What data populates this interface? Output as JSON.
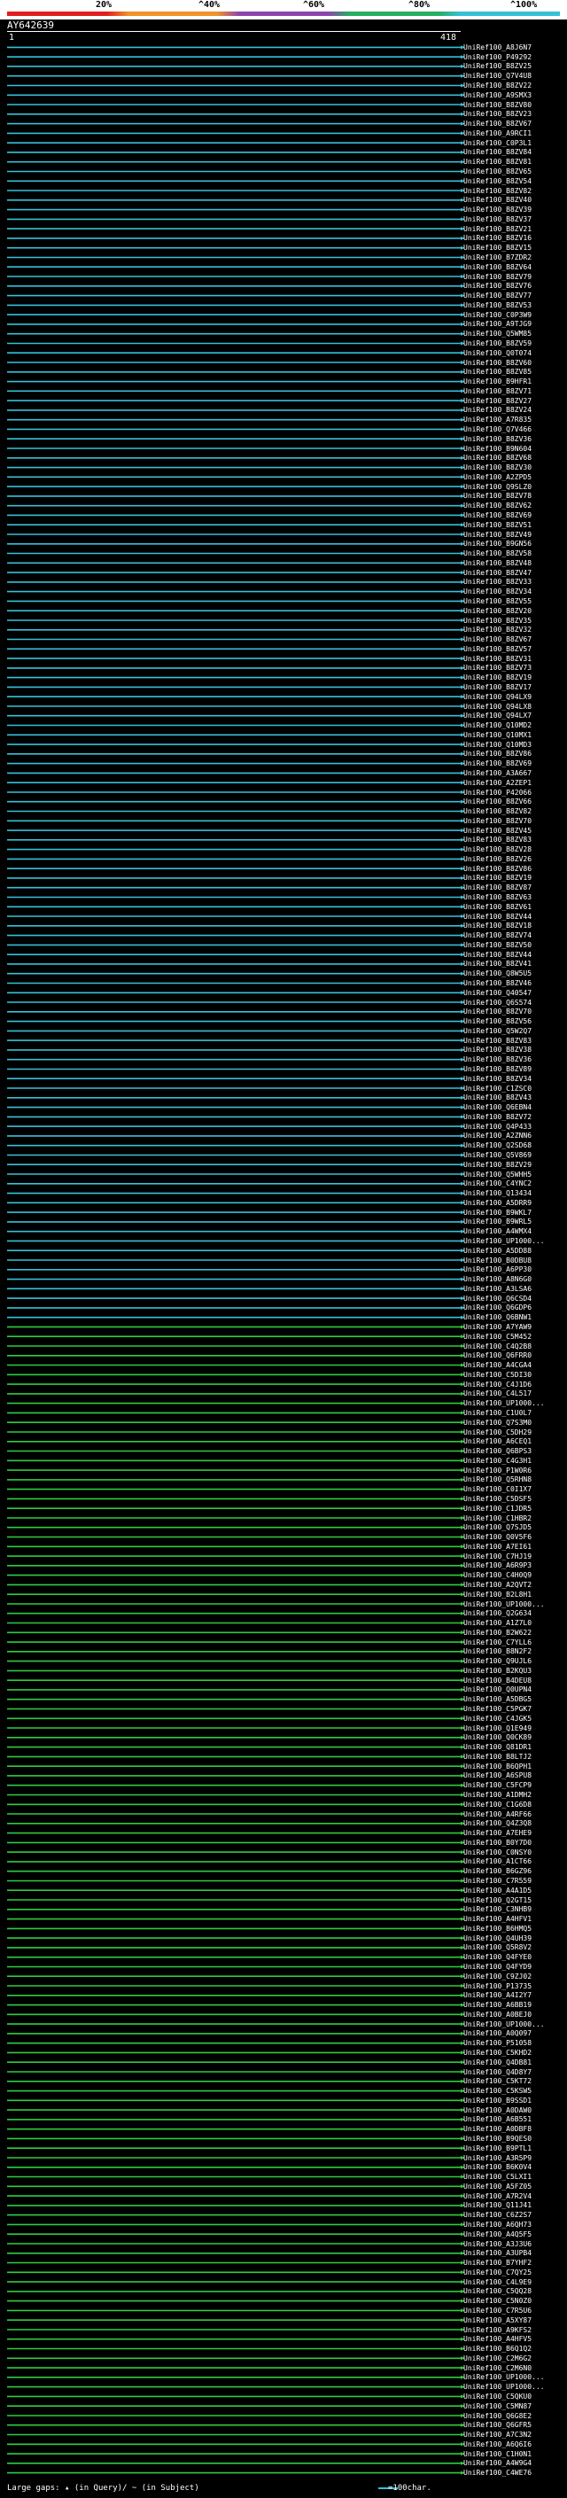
{
  "header": {
    "scale_labels": [
      "20%",
      "^40%",
      "^60%",
      "^80%",
      "^100%"
    ],
    "gradient_colors": [
      "#e11d1d",
      "#f0932a",
      "#8e44ad",
      "#27ae60",
      "#37c1d6"
    ]
  },
  "query": {
    "name": "AY642639",
    "start": "1",
    "end": "418"
  },
  "colors": {
    "cyan": "#37c1d6",
    "green": "#2ecc40",
    "gap": "#ffffff"
  },
  "hits": {
    "cyan_labels": [
      "UniRef100_A8J6N7",
      "UniRef100_P49292",
      "UniRef100_B8ZV25",
      "UniRef100_Q7V4U8",
      "UniRef100_B8ZV22",
      "UniRef100_A9SMX3",
      "UniRef100_B8ZV80",
      "UniRef100_B8ZV23",
      "UniRef100_B8ZV67",
      "UniRef100_A9RCI1",
      "UniRef100_C0P3L1",
      "UniRef100_B8ZV84",
      "UniRef100_B8ZV81",
      "UniRef100_B8ZV65",
      "UniRef100_B8ZV54",
      "UniRef100_B8ZV82",
      "UniRef100_B8ZV40",
      "UniRef100_B8ZV39",
      "UniRef100_B8ZV37",
      "UniRef100_B8ZV21",
      "UniRef100_B8ZV16",
      "UniRef100_B8ZV15",
      "UniRef100_B7ZDR2",
      "UniRef100_B8ZV64",
      "UniRef100_B8ZV79",
      "UniRef100_B8ZV76",
      "UniRef100_B8ZV77",
      "UniRef100_B8ZV53",
      "UniRef100_C0P3W9",
      "UniRef100_A9TJG9",
      "UniRef100_Q5WM85",
      "UniRef100_B8ZV59",
      "UniRef100_Q0T074",
      "UniRef100_B8ZV60",
      "UniRef100_B8ZV85",
      "UniRef100_B9HFR1",
      "UniRef100_B8ZV71",
      "UniRef100_B8ZV27",
      "UniRef100_B8ZV24",
      "UniRef100_A7R835",
      "UniRef100_Q7V466",
      "UniRef100_B8ZV36",
      "UniRef100_B9N604",
      "UniRef100_B8ZV68",
      "UniRef100_B8ZV30",
      "UniRef100_A2ZPD5",
      "UniRef100_Q9SLZ0",
      "UniRef100_B8ZV78",
      "UniRef100_B8ZV62",
      "UniRef100_B8ZV69",
      "UniRef100_B8ZV51",
      "UniRef100_B8ZV49",
      "UniRef100_B9GN56",
      "UniRef100_B8ZV58",
      "UniRef100_B8ZV48",
      "UniRef100_B8ZV47",
      "UniRef100_B8ZV33",
      "UniRef100_B8ZV34",
      "UniRef100_B8ZV55",
      "UniRef100_B8ZV20",
      "UniRef100_B8ZV35",
      "UniRef100_B8ZV32",
      "UniRef100_B8ZV67",
      "UniRef100_B8ZV57",
      "UniRef100_B8ZV31",
      "UniRef100_B8ZV73",
      "UniRef100_B8ZV19",
      "UniRef100_B8ZV17",
      "UniRef100_Q94LX9",
      "UniRef100_Q94LX8",
      "UniRef100_Q94LX7",
      "UniRef100_Q10MD2",
      "UniRef100_Q10MX1",
      "UniRef100_Q10MD3",
      "UniRef100_B8ZV86",
      "UniRef100_B8ZV69",
      "UniRef100_A3A667",
      "UniRef100_A2ZEP1",
      "UniRef100_P42066",
      "UniRef100_B8ZV66",
      "UniRef100_B8ZV82",
      "UniRef100_B8ZV70",
      "UniRef100_B8ZV45",
      "UniRef100_B8ZV83",
      "UniRef100_B8ZV28",
      "UniRef100_B8ZV26",
      "UniRef100_B8ZV86",
      "UniRef100_B8ZV19",
      "UniRef100_B8ZV87",
      "UniRef100_B8ZV63",
      "UniRef100_B8ZV61",
      "UniRef100_B8ZV44",
      "UniRef100_B8ZV18",
      "UniRef100_B8ZV74",
      "UniRef100_B8ZV50",
      "UniRef100_B8ZV44",
      "UniRef100_B8ZV41",
      "UniRef100_Q8W5U5",
      "UniRef100_B8ZV46",
      "UniRef100_Q40547",
      "UniRef100_Q6S574",
      "UniRef100_B8ZV70",
      "UniRef100_B8ZV56",
      "UniRef100_Q5W2Q7",
      "UniRef100_B8ZV83",
      "UniRef100_B8ZV38",
      "UniRef100_B8ZV36",
      "UniRef100_B8ZV89",
      "UniRef100_B8ZV34",
      "UniRef100_C1ZSC0",
      "UniRef100_B8ZV43",
      "UniRef100_Q6EBN4",
      "UniRef100_B8ZV72",
      "UniRef100_Q4P433",
      "UniRef100_A2ZNN6",
      "UniRef100_Q2SD68",
      "UniRef100_Q5V869",
      "UniRef100_B8ZV29",
      "UniRef100_Q5WHH5",
      "UniRef100_C4YNC2",
      "UniRef100_Q13434",
      "UniRef100_A5DRR9",
      "UniRef100_B9WKL7",
      "UniRef100_B9WRL5",
      "UniRef100_A4WMX4",
      "UniRef100_UP1000...",
      "UniRef100_A5DD88",
      "UniRef100_B0DBU8",
      "UniRef100_A6PP30",
      "UniRef100_A8N6G0",
      "UniRef100_A3LSA6",
      "UniRef100_Q6CSD4",
      "UniRef100_Q6GDP6",
      "UniRef100_Q6BNW1"
    ],
    "green_labels": [
      "UniRef100_A7YAW9",
      "UniRef100_C5M452",
      "UniRef100_C4Q2B8",
      "UniRef100_Q6FRR0",
      "UniRef100_A4CGA4",
      "UniRef100_C5DI30",
      "UniRef100_C4J1D6",
      "UniRef100_C4L517",
      "UniRef100_UP1000...",
      "UniRef100_C1U0L7",
      "UniRef100_Q7S3M0",
      "UniRef100_C5DH29",
      "UniRef100_A6CEQ1",
      "UniRef100_Q6BPS3",
      "UniRef100_C4G3H1",
      "UniRef100_P1W0R6",
      "UniRef100_Q5RHN8",
      "UniRef100_C0I1X7",
      "UniRef100_C5DSF5",
      "UniRef100_C1JDR5",
      "UniRef100_C1HBR2",
      "UniRef100_Q7SJD5",
      "UniRef100_Q0V5F6",
      "UniRef100_A7EI61",
      "UniRef100_C7HJ19",
      "UniRef100_A6R9P3",
      "UniRef100_C4H0Q9",
      "UniRef100_A2QVT2",
      "UniRef100_B2L8H1",
      "UniRef100_UP1000...",
      "UniRef100_Q2G634",
      "UniRef100_A1Z7L0",
      "UniRef100_B2W622",
      "UniRef100_C7YLL6",
      "UniRef100_B8N2F2",
      "UniRef100_Q9UJL6",
      "UniRef100_B2KQU3",
      "UniRef100_B4DEU8",
      "UniRef100_Q0UPN4",
      "UniRef100_A5DBG5",
      "UniRef100_C5PGK7",
      "UniRef100_C4JGK5",
      "UniRef100_Q1E949",
      "UniRef100_Q0CK89",
      "UniRef100_Q81DR1",
      "UniRef100_B8LTJ2",
      "UniRef100_B6QPH1",
      "UniRef100_A6SPU8",
      "UniRef100_C5FCP9",
      "UniRef100_A1DMH2",
      "UniRef100_C1G6D8",
      "UniRef100_A4RF66",
      "UniRef100_Q4Z3Q8",
      "UniRef100_A7EHE9",
      "UniRef100_B0Y7D0",
      "UniRef100_C0NSY0",
      "UniRef100_A1CT66",
      "UniRef100_B6GZ96",
      "UniRef100_C7R559",
      "UniRef100_A4A1D5",
      "UniRef100_Q2GT15",
      "UniRef100_C3NHB9",
      "UniRef100_A4HFV1",
      "UniRef100_B6HMQ5",
      "UniRef100_Q4UH39",
      "UniRef100_Q5R8V2",
      "UniRef100_Q4FYE0",
      "UniRef100_Q4FYD9",
      "UniRef100_C9ZJ02",
      "UniRef100_P13735",
      "UniRef100_A4I2Y7",
      "UniRef100_A6BB19",
      "UniRef100_A0BEJ0",
      "UniRef100_UP1000...",
      "UniRef100_A0Q097",
      "UniRef100_P51058",
      "UniRef100_C5KHD2",
      "UniRef100_Q4DB81",
      "UniRef100_Q4D8Y7",
      "UniRef100_C5KT72",
      "UniRef100_C5KSW5",
      "UniRef100_B9SSD1",
      "UniRef100_A0DAW0",
      "UniRef100_A6B551",
      "UniRef100_A0DBF8",
      "UniRef100_B9QES0",
      "UniRef100_B9PTL1",
      "UniRef100_A3R5P9",
      "UniRef100_B6K0V4",
      "UniRef100_C5LXI1",
      "UniRef100_A5FZ05",
      "UniRef100_A7R2V4",
      "UniRef100_Q11J41",
      "UniRef100_C6Z2S7",
      "UniRef100_A6QH73",
      "UniRef100_A4Q5F5",
      "UniRef100_A3J3U6",
      "UniRef100_A3UPB4",
      "UniRef100_B7YHF2",
      "UniRef100_C7QY25",
      "UniRef100_C4L9E9",
      "UniRef100_C5QQ28",
      "UniRef100_C5N0Z0",
      "UniRef100_C7R5U6",
      "UniRef100_A5XY87",
      "UniRef100_A9KFS2",
      "UniRef100_A4HFV5",
      "UniRef100_B6Q1Q2",
      "UniRef100_C2M6G2",
      "UniRef100_C2M6N0",
      "UniRef100_UP1000...",
      "UniRef100_UP1000...",
      "UniRef100_C5QKU0",
      "UniRef100_C5MN87",
      "UniRef100_Q6G8E2",
      "UniRef100_Q6GFR5",
      "UniRef100_A7C3N2",
      "UniRef100_A6Q6I6",
      "UniRef100_C1H0N1",
      "UniRef100_A4W9G4",
      "UniRef100_C4WE76"
    ]
  },
  "footer": {
    "gaps_text": "Large gaps: ▴ (in Query)/ ~ (in Subject)",
    "scale_text": "=100char."
  }
}
